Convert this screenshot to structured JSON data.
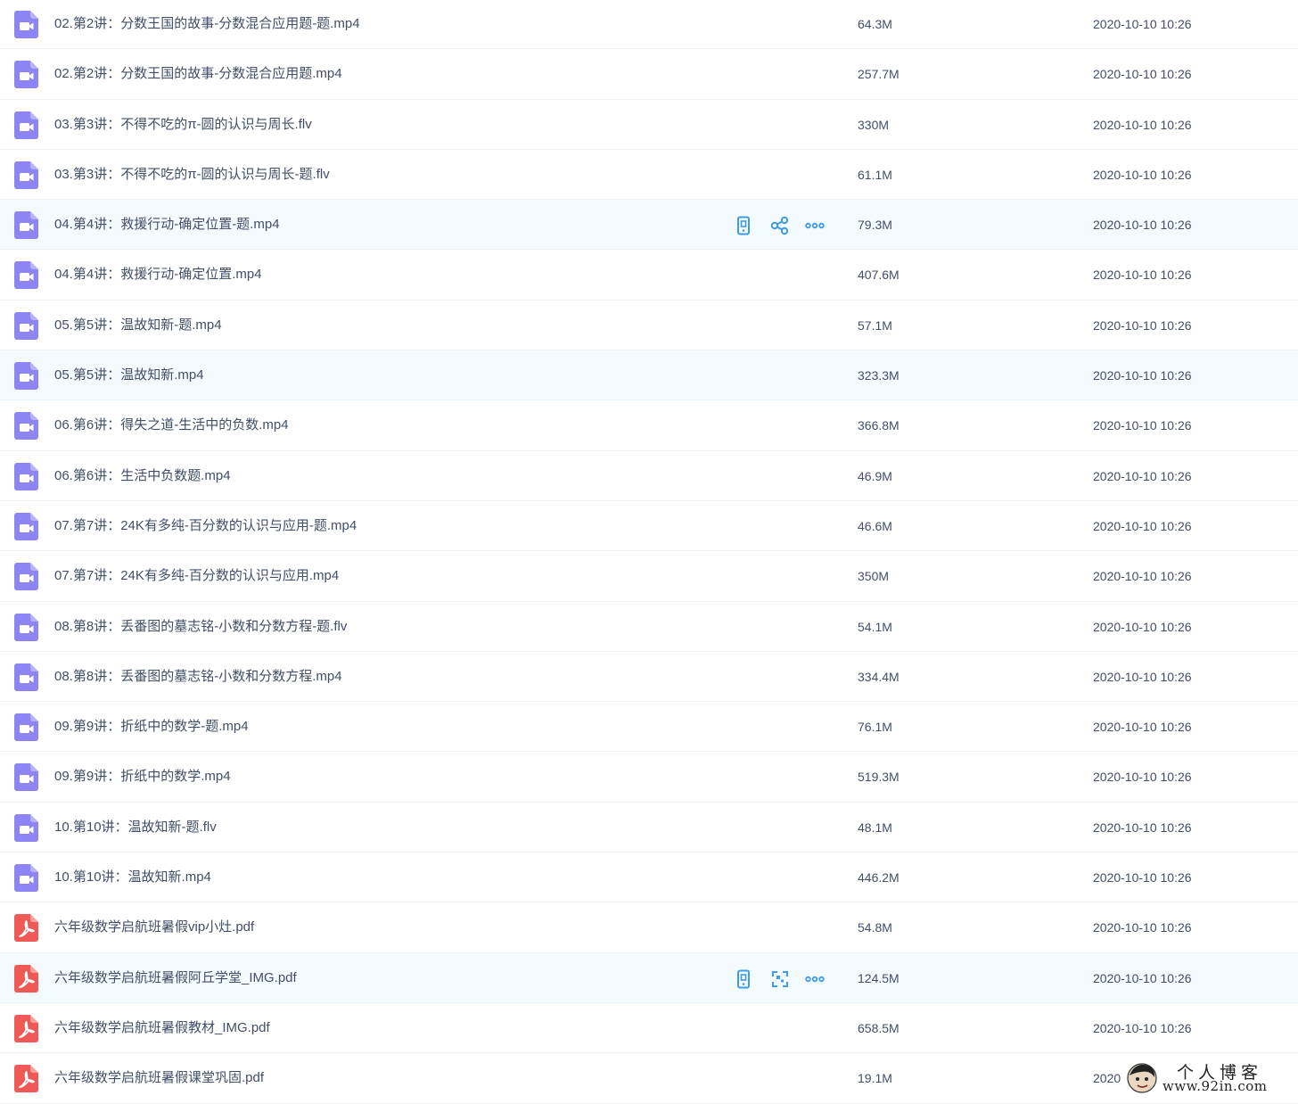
{
  "files": [
    {
      "name": "02.第2讲：分数王国的故事-分数混合应用题-题.mp4",
      "type": "video",
      "size": "64.3M",
      "date": "2020-10-10 10:26"
    },
    {
      "name": "02.第2讲：分数王国的故事-分数混合应用题.mp4",
      "type": "video",
      "size": "257.7M",
      "date": "2020-10-10 10:26"
    },
    {
      "name": "03.第3讲：不得不吃的π-圆的认识与周长.flv",
      "type": "video",
      "size": "330M",
      "date": "2020-10-10 10:26"
    },
    {
      "name": "03.第3讲：不得不吃的π-圆的认识与周长-题.flv",
      "type": "video",
      "size": "61.1M",
      "date": "2020-10-10 10:26"
    },
    {
      "name": "04.第4讲：救援行动-确定位置-题.mp4",
      "type": "video",
      "size": "79.3M",
      "date": "2020-10-10 10:26",
      "hover": true,
      "actions": [
        "mobile-icon",
        "share-icon",
        "more-icon"
      ]
    },
    {
      "name": "04.第4讲：救援行动-确定位置.mp4",
      "type": "video",
      "size": "407.6M",
      "date": "2020-10-10 10:26"
    },
    {
      "name": "05.第5讲：温故知新-题.mp4",
      "type": "video",
      "size": "57.1M",
      "date": "2020-10-10 10:26"
    },
    {
      "name": "05.第5讲：温故知新.mp4",
      "type": "video",
      "size": "323.3M",
      "date": "2020-10-10 10:26",
      "hover": true
    },
    {
      "name": "06.第6讲：得失之道-生活中的负数.mp4",
      "type": "video",
      "size": "366.8M",
      "date": "2020-10-10 10:26"
    },
    {
      "name": "06.第6讲：生活中负数题.mp4",
      "type": "video",
      "size": "46.9M",
      "date": "2020-10-10 10:26"
    },
    {
      "name": "07.第7讲：24K有多纯-百分数的认识与应用-题.mp4",
      "type": "video",
      "size": "46.6M",
      "date": "2020-10-10 10:26"
    },
    {
      "name": "07.第7讲：24K有多纯-百分数的认识与应用.mp4",
      "type": "video",
      "size": "350M",
      "date": "2020-10-10 10:26"
    },
    {
      "name": "08.第8讲：丢番图的墓志铭-小数和分数方程-题.flv",
      "type": "video",
      "size": "54.1M",
      "date": "2020-10-10 10:26"
    },
    {
      "name": "08.第8讲：丢番图的墓志铭-小数和分数方程.mp4",
      "type": "video",
      "size": "334.4M",
      "date": "2020-10-10 10:26"
    },
    {
      "name": "09.第9讲：折纸中的数学-题.mp4",
      "type": "video",
      "size": "76.1M",
      "date": "2020-10-10 10:26"
    },
    {
      "name": "09.第9讲：折纸中的数学.mp4",
      "type": "video",
      "size": "519.3M",
      "date": "2020-10-10 10:26"
    },
    {
      "name": "10.第10讲：温故知新-题.flv",
      "type": "video",
      "size": "48.1M",
      "date": "2020-10-10 10:26"
    },
    {
      "name": "10.第10讲：温故知新.mp4",
      "type": "video",
      "size": "446.2M",
      "date": "2020-10-10 10:26"
    },
    {
      "name": "六年级数学启航班暑假vip小灶.pdf",
      "type": "pdf",
      "size": "54.8M",
      "date": "2020-10-10 10:26"
    },
    {
      "name": "六年级数学启航班暑假阿丘学堂_IMG.pdf",
      "type": "pdf",
      "size": "124.5M",
      "date": "2020-10-10 10:26",
      "hover": true,
      "actions": [
        "mobile-icon",
        "scan-icon",
        "more-icon"
      ]
    },
    {
      "name": "六年级数学启航班暑假教材_IMG.pdf",
      "type": "pdf",
      "size": "658.5M",
      "date": "2020-10-10 10:26"
    },
    {
      "name": "六年级数学启航班暑假课堂巩固.pdf",
      "type": "pdf",
      "size": "19.1M",
      "date": "2020"
    }
  ],
  "watermark": {
    "title": "个人博客",
    "url": "www.92in.com"
  },
  "colors": {
    "video_icon": "#8c85f3",
    "pdf_icon": "#f05a56",
    "action_icon": "#3d9be9",
    "text": "#424e67",
    "hover_bg": "#f4fbff"
  }
}
